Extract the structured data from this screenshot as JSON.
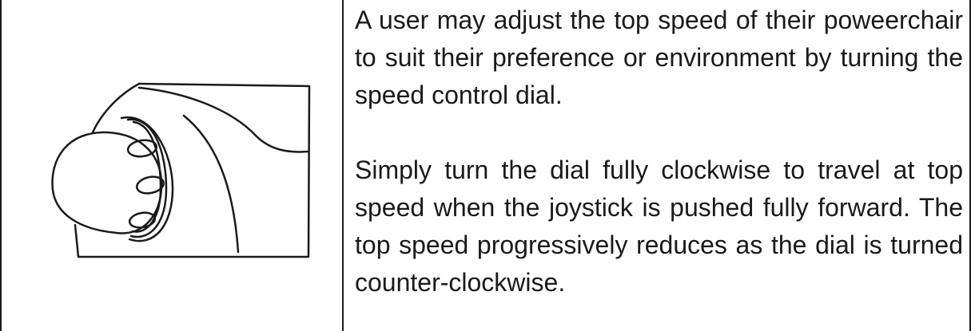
{
  "figure": {
    "icon": "joystick-speed-dial-icon"
  },
  "instructions": {
    "paragraph_1": "A user may adjust the top speed of their poweerchair to suit their preference or environment by turning the speed control dial.",
    "paragraph_2": "Simply turn the dial fully clockwise to travel at top speed when the joystick is pushed fully forward. The top speed progressively reduces as the dial is turned counter-clockwise."
  }
}
